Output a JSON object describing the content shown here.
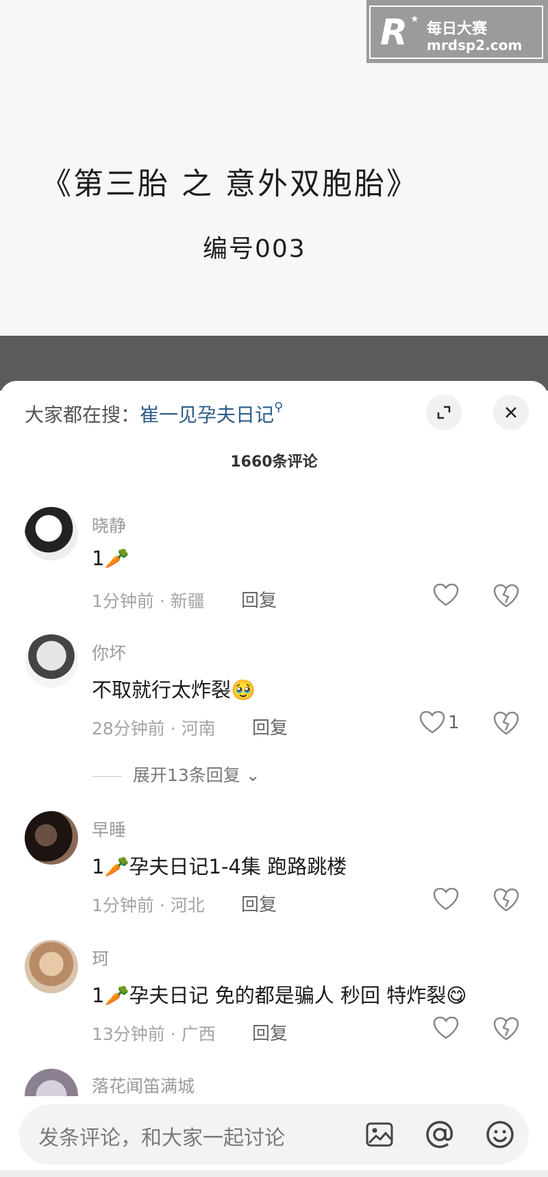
{
  "video": {
    "title": "《第三胎 之 意外双胞胎》",
    "code": "编号003",
    "watermark": {
      "logo": "R",
      "cn": "每日大赛",
      "url": "mrdsp2.com"
    }
  },
  "sheet": {
    "search_prefix": "大家都在搜：",
    "search_keyword": "崔一见孕夫日记",
    "comment_count": "1660条评论",
    "icons": {
      "expand": "expand-icon",
      "close": "close-icon"
    }
  },
  "comments": [
    {
      "user": "晓静",
      "text": "1🥕",
      "time_loc": "1分钟前 · 新疆",
      "reply": "回复",
      "likes": ""
    },
    {
      "user": "你坏",
      "text": "不取就行太炸裂🥹",
      "time_loc": "28分钟前 · 河南",
      "reply": "回复",
      "likes": "1",
      "expand": "展开13条回复"
    },
    {
      "user": "早睡",
      "text": "1🥕孕夫日记1-4集  跑路跳楼",
      "time_loc": "1分钟前 · 河北",
      "reply": "回复",
      "likes": ""
    },
    {
      "user": "珂",
      "text": "1🥕孕夫日记 免的都是骗人 秒回 特炸裂😋",
      "time_loc": "13分钟前 · 广西",
      "reply": "回复",
      "likes": ""
    },
    {
      "user": "落花闻笛满城"
    }
  ],
  "input": {
    "placeholder": "发条评论，和大家一起讨论",
    "icons": [
      "image-icon",
      "at-icon",
      "emoji-icon"
    ]
  }
}
